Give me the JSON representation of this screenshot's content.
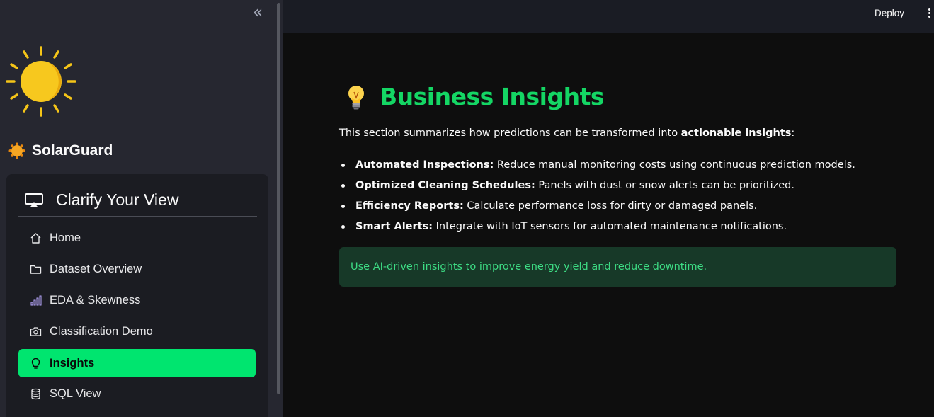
{
  "sidebar": {
    "collapse_icon": "double-chevron-left-icon",
    "logo_icon": "sun-icon",
    "brand": {
      "icon": "sun-emoji-icon",
      "name": "SolarGuard"
    },
    "menu": {
      "title": "Clarify Your View",
      "title_icon": "screen-cast-icon",
      "items": [
        {
          "label": "Home",
          "icon": "house-icon",
          "active": false
        },
        {
          "label": "Dataset Overview",
          "icon": "folder-icon",
          "active": false
        },
        {
          "label": "EDA & Skewness",
          "icon": "bar-chart-icon",
          "active": false
        },
        {
          "label": "Classification Demo",
          "icon": "camera-icon",
          "active": false
        },
        {
          "label": "Insights",
          "icon": "lightbulb-icon",
          "active": true
        },
        {
          "label": "SQL View",
          "icon": "database-icon",
          "active": false
        }
      ]
    }
  },
  "header": {
    "deploy_label": "Deploy",
    "menu_icon": "kebab-menu-icon"
  },
  "main": {
    "title_icon": "lightbulb-emoji-icon",
    "title": "Business Insights",
    "intro_prefix": "This section summarizes how predictions can be transformed into ",
    "intro_bold": "actionable insights",
    "intro_suffix": ":",
    "bullets": [
      {
        "bold": "Automated Inspections:",
        "text": " Reduce manual monitoring costs using continuous prediction models."
      },
      {
        "bold": "Optimized Cleaning Schedules:",
        "text": " Panels with dust or snow alerts can be prioritized."
      },
      {
        "bold": "Efficiency Reports:",
        "text": " Calculate performance loss for dirty or damaged panels."
      },
      {
        "bold": "Smart Alerts:",
        "text": " Integrate with IoT sensors for automated maintenance notifications."
      }
    ],
    "success_message": "Use AI-driven insights to improve energy yield and reduce downtime."
  },
  "colors": {
    "accent": "#00e56f",
    "title_green": "#14d664",
    "sidebar_bg": "#262730",
    "alert_bg": "#173928",
    "alert_text": "#3ddc84"
  }
}
